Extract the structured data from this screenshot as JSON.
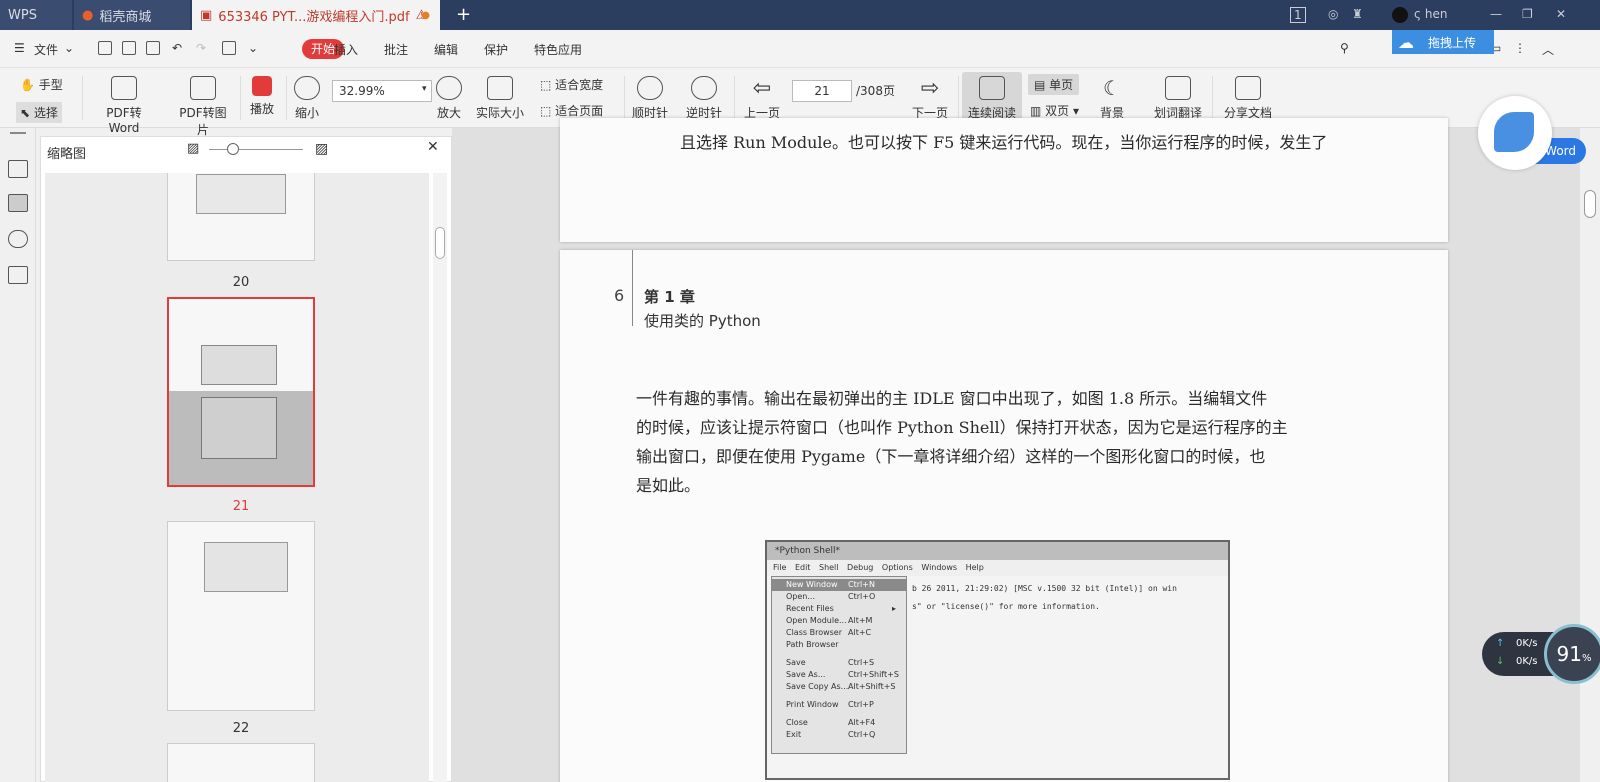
{
  "tabs": {
    "wps": "WPS",
    "shop": "稻壳商城",
    "doc": "653346 PYT...游戏编程入门.pdf"
  },
  "user": {
    "name": "ς hen",
    "badge": "1"
  },
  "menu": {
    "file": "文件",
    "items": [
      "开始",
      "插入",
      "批注",
      "编辑",
      "保护",
      "特色应用"
    ]
  },
  "upload_label": "拖拽上传",
  "toolbar": {
    "hand": "手型",
    "select": "选择",
    "pdf_to_word": "PDF转Word",
    "pdf_to_image": "PDF转图片",
    "play": "播放",
    "zoom_out": "缩小",
    "zoom_value": "32.99%",
    "zoom_in": "放大",
    "actual_size": "实际大小",
    "fit_width": "适合宽度",
    "fit_page": "适合页面",
    "rotate_cw": "顺时针",
    "rotate_ccw": "逆时针",
    "prev": "上一页",
    "page_current": "21",
    "page_total": "/308页",
    "next": "下一页",
    "continuous": "连续阅读",
    "single": "单页",
    "double": "双页",
    "background": "背景",
    "translate": "划词翻译",
    "share": "分享文档"
  },
  "thumb_panel": {
    "title": "缩略图",
    "pages": [
      "20",
      "21",
      "22"
    ]
  },
  "page_prev": {
    "line": "且选择 Run Module。也可以按下 F5 键来运行代码。现在，当你运行程序的时候，发生了"
  },
  "page_main": {
    "number": "6",
    "chapter": "第 1 章",
    "chapter_title": "使用类的 Python",
    "paragraph": [
      "一件有趣的事情。输出在最初弹出的主 IDLE 窗口中出现了，如图 1.8 所示。当编辑文件",
      "的时候，应该让提示符窗口（也叫作 Python Shell）保持打开状态，因为它是运行程序的主",
      "输出窗口，即便在使用 Pygame（下一章将详细介绍）这样的一个图形化窗口的时候，也",
      "是如此。"
    ],
    "figure": {
      "title": "*Python Shell*",
      "menus": [
        "File",
        "Edit",
        "Shell",
        "Debug",
        "Options",
        "Windows",
        "Help"
      ],
      "line1": "b 26 2011, 21:29:02) [MSC v.1500 32 bit (Intel)] on win",
      "line2": "s\" or \"license()\" for more information.",
      "items": [
        {
          "label": "New Window",
          "key": "Ctrl+N"
        },
        {
          "label": "Open...",
          "key": "Ctrl+O"
        },
        {
          "label": "Recent Files",
          "key": "▸"
        },
        {
          "label": "Open Module...",
          "key": "Alt+M"
        },
        {
          "label": "Class Browser",
          "key": "Alt+C"
        },
        {
          "label": "Path Browser",
          "key": ""
        },
        {
          "label": "Save",
          "key": "Ctrl+S"
        },
        {
          "label": "Save As...",
          "key": "Ctrl+Shift+S"
        },
        {
          "label": "Save Copy As...",
          "key": "Alt+Shift+S"
        },
        {
          "label": "Print Window",
          "key": "Ctrl+P"
        },
        {
          "label": "Close",
          "key": "Alt+F4"
        },
        {
          "label": "Exit",
          "key": "Ctrl+Q"
        }
      ]
    }
  },
  "assistant": {
    "word_label": "Word"
  },
  "net_monitor": {
    "up": "0K/s",
    "down": "0K/s",
    "percent": "91",
    "unit": "%"
  }
}
